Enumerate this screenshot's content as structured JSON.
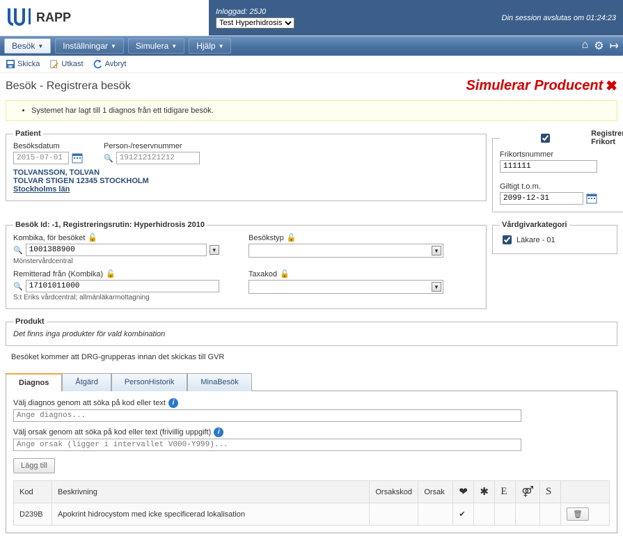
{
  "header": {
    "app_name": "RAPP",
    "logged_in_label": "Inloggad: 25J0",
    "context_select_value": "Test Hyperhidrosis",
    "session_text": "Din session avslutas om 01:24:23"
  },
  "menu": {
    "items": [
      "Besök",
      "Inställningar",
      "Simulera",
      "Hjälp"
    ]
  },
  "toolbar": {
    "skicka": "Skicka",
    "utkast": "Utkast",
    "avbryt": "Avbryt"
  },
  "page": {
    "title": "Besök - Registrera besök",
    "sim_banner": "Simulerar Producent"
  },
  "notice": {
    "text": "Systemet har lagt till 1 diagnos från ett tidigare besök."
  },
  "patient": {
    "legend": "Patient",
    "besoksdatum_label": "Besöksdatum",
    "besoksdatum_value": "2015-07-01",
    "person_label": "Person-/reservnummer",
    "person_value": "191212121212",
    "name": "TOLVANSSON, TOLVAN",
    "address": "TOLVAR STIGEN  12345  STOCKHOLM",
    "region": "Stockholms län"
  },
  "frikort": {
    "checkbox_label": "Registrera Frikort",
    "nummer_label": "Frikortsnummer",
    "nummer_value": "111111",
    "giltigt_label": "Giltigt t.o.m.",
    "giltigt_value": "2099-12-31"
  },
  "visit": {
    "legend": "Besök  Id: -1, Registreringsrutin: Hyperhidrosis 2010",
    "kombika_label": "Kombika, för besöket",
    "kombika_value": "1001388900",
    "kombika_note": "Mönstervårdcentral",
    "besokstyp_label": "Besökstyp",
    "remitterad_label": "Remitterad från (Kombika)",
    "remitterad_value": "17101011000",
    "remitterad_note": "S:t Eriks vårdcentral; allmänläkarmottagning",
    "taxakod_label": "Taxakod"
  },
  "vardgivarkategori": {
    "legend": "Vårdgivarkategori",
    "value": "Läkare - 01"
  },
  "produkt": {
    "legend": "Produkt",
    "no_products": "Det finns inga produkter för vald kombination",
    "drg_note": "Besöket kommer att DRG-grupperas innan det skickas till GVR"
  },
  "tabs": {
    "items": [
      "Diagnos",
      "Åtgärd",
      "PersonHistorik",
      "MinaBesök"
    ]
  },
  "diagnos_panel": {
    "search_label": "Välj diagnos genom att söka på kod eller text",
    "search_placeholder": "Ange diagnos...",
    "orsak_label": "Välj orsak genom att söka på kod eller text (frivillig uppgift)",
    "orsak_placeholder": "Ange orsak (ligger i intervallet V000-Y999)...",
    "add_button": "Lägg till",
    "table": {
      "headers": {
        "kod": "Kod",
        "beskrivning": "Beskrivning",
        "orsakskod": "Orsakskod",
        "orsak": "Orsak",
        "col_e": "E",
        "col_s": "S"
      },
      "rows": [
        {
          "kod": "D239B",
          "beskrivning": "Apokrint hidrocystom med icke specificerad lokalisation",
          "orsakskod": "",
          "orsak": "",
          "main": true
        }
      ]
    }
  }
}
